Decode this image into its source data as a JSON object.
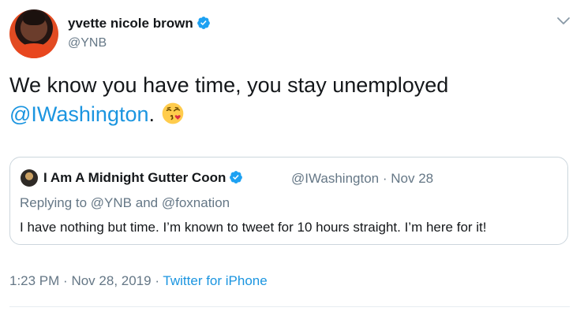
{
  "author": {
    "display_name": "yvette nicole brown",
    "handle": "@YNB",
    "verified": true
  },
  "tweet": {
    "text_before_mention": "We know you have time, you stay unemployed",
    "mention": "@IWashington",
    "text_after_mention": ".",
    "emoji": "face-blowing-a-kiss"
  },
  "quoted_tweet": {
    "display_name": "I Am A Midnight Gutter Coon",
    "verified": true,
    "handle": "@IWashington",
    "separator": "·",
    "date": "Nov 28",
    "replying_prefix": "Replying to",
    "replying_to_1": "@YNB",
    "replying_joiner": "and",
    "replying_to_2": "@foxnation",
    "text": "I have nothing but time. I’m known to tweet for 10 hours straight. I’m here for it!"
  },
  "footer": {
    "time": "1:23 PM",
    "separator": "·",
    "date": "Nov 28, 2019",
    "source": "Twitter for iPhone"
  },
  "colors": {
    "link": "#1b95e0",
    "secondary": "#657786",
    "border": "#ccd6dd",
    "verified": "#1da1f2"
  }
}
